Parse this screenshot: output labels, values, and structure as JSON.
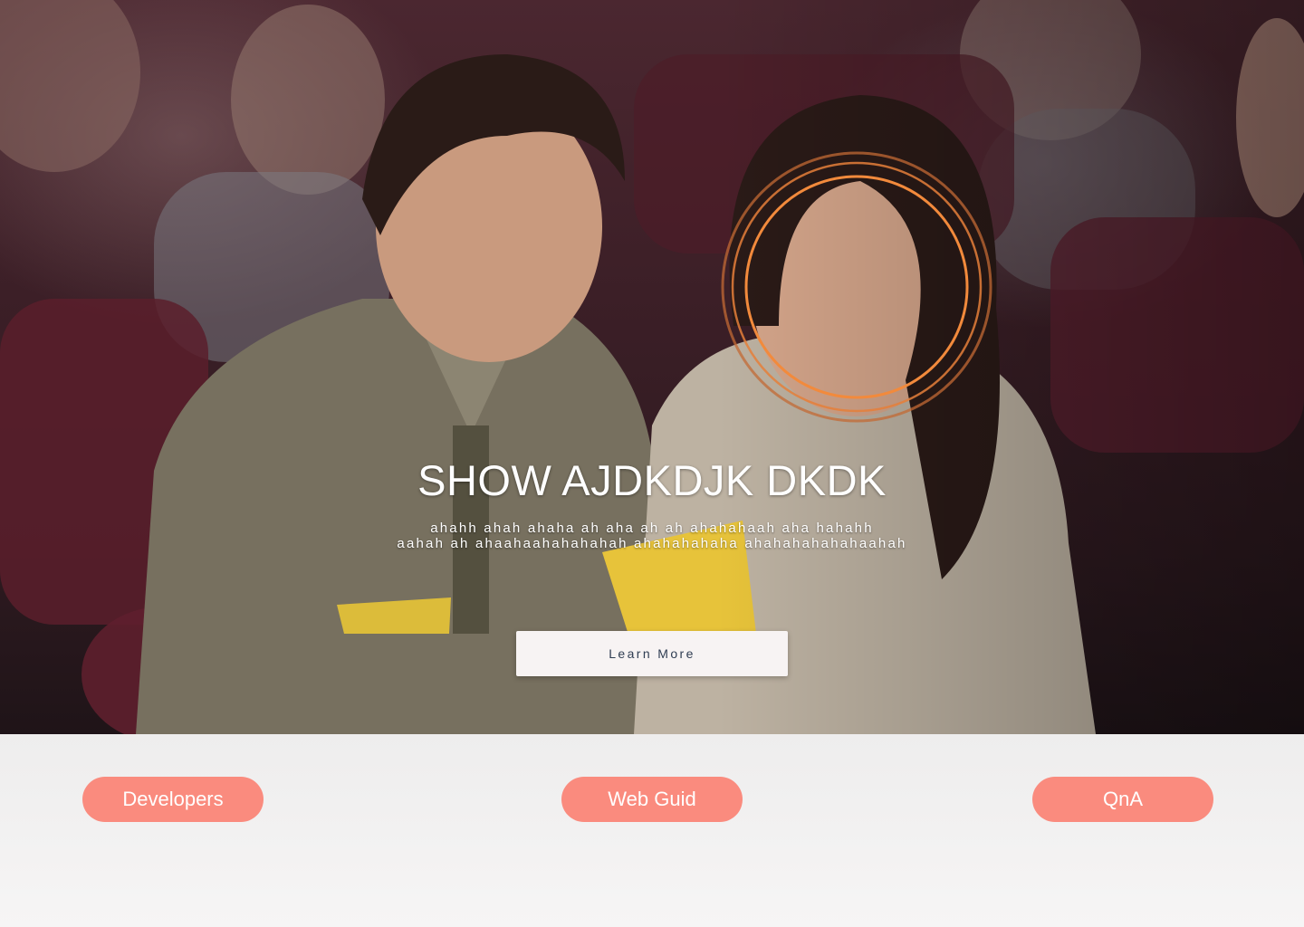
{
  "hero": {
    "title": "SHOW AJDKDJK DKDK",
    "subtitle_line1": "ahahh ahah ahaha ah aha ah ah ahahahaah aha hahahh",
    "subtitle_line2": "aahah ah ahaahaahahahahah ahahahahaha ahahahahahahaahah",
    "cta_label": "Learn More",
    "ring_color": "#f28a3c"
  },
  "nav_pills": {
    "developers": "Developers",
    "web_guide": "Web Guid",
    "qna": "QnA",
    "pill_color": "#fa8b7e"
  }
}
